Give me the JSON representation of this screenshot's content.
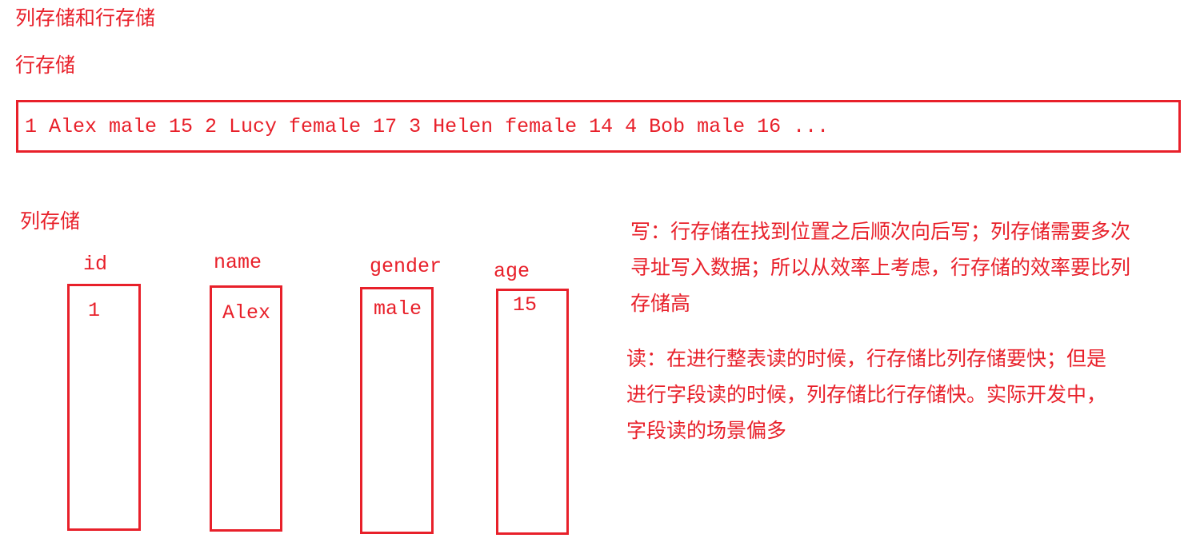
{
  "title": "列存储和行存储",
  "row_storage": {
    "label": "行存储",
    "content": "1 Alex male 15 2 Lucy female 17 3 Helen female 14 4 Bob male 16 ..."
  },
  "column_storage": {
    "label": "列存储",
    "columns": [
      {
        "header": "id",
        "value": "1"
      },
      {
        "header": "name",
        "value": "Alex"
      },
      {
        "header": "gender",
        "value": "male"
      },
      {
        "header": "age",
        "value": "15"
      }
    ]
  },
  "notes": {
    "write": [
      "写：行存储在找到位置之后顺次向后写；列存储需要多次",
      "寻址写入数据；所以从效率上考虑，行存储的效率要比列",
      "存储高"
    ],
    "read": [
      "读：在进行整表读的时候，行存储比列存储要快；但是",
      "进行字段读的时候，列存储比行存储快。实际开发中，",
      "字段读的场景偏多"
    ]
  },
  "colors": {
    "accent": "#e8202a"
  }
}
